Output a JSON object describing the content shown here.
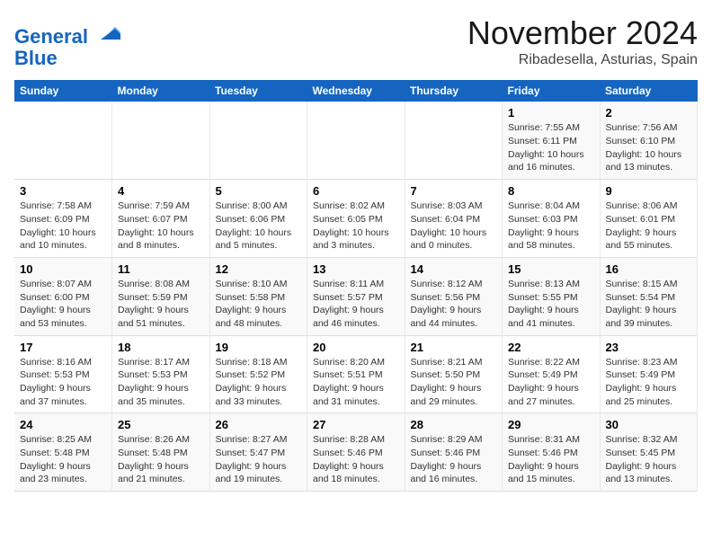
{
  "header": {
    "logo_line1": "General",
    "logo_line2": "Blue",
    "month": "November 2024",
    "location": "Ribadesella, Asturias, Spain"
  },
  "weekdays": [
    "Sunday",
    "Monday",
    "Tuesday",
    "Wednesday",
    "Thursday",
    "Friday",
    "Saturday"
  ],
  "weeks": [
    [
      {
        "day": "",
        "info": ""
      },
      {
        "day": "",
        "info": ""
      },
      {
        "day": "",
        "info": ""
      },
      {
        "day": "",
        "info": ""
      },
      {
        "day": "",
        "info": ""
      },
      {
        "day": "1",
        "info": "Sunrise: 7:55 AM\nSunset: 6:11 PM\nDaylight: 10 hours and 16 minutes."
      },
      {
        "day": "2",
        "info": "Sunrise: 7:56 AM\nSunset: 6:10 PM\nDaylight: 10 hours and 13 minutes."
      }
    ],
    [
      {
        "day": "3",
        "info": "Sunrise: 7:58 AM\nSunset: 6:09 PM\nDaylight: 10 hours and 10 minutes."
      },
      {
        "day": "4",
        "info": "Sunrise: 7:59 AM\nSunset: 6:07 PM\nDaylight: 10 hours and 8 minutes."
      },
      {
        "day": "5",
        "info": "Sunrise: 8:00 AM\nSunset: 6:06 PM\nDaylight: 10 hours and 5 minutes."
      },
      {
        "day": "6",
        "info": "Sunrise: 8:02 AM\nSunset: 6:05 PM\nDaylight: 10 hours and 3 minutes."
      },
      {
        "day": "7",
        "info": "Sunrise: 8:03 AM\nSunset: 6:04 PM\nDaylight: 10 hours and 0 minutes."
      },
      {
        "day": "8",
        "info": "Sunrise: 8:04 AM\nSunset: 6:03 PM\nDaylight: 9 hours and 58 minutes."
      },
      {
        "day": "9",
        "info": "Sunrise: 8:06 AM\nSunset: 6:01 PM\nDaylight: 9 hours and 55 minutes."
      }
    ],
    [
      {
        "day": "10",
        "info": "Sunrise: 8:07 AM\nSunset: 6:00 PM\nDaylight: 9 hours and 53 minutes."
      },
      {
        "day": "11",
        "info": "Sunrise: 8:08 AM\nSunset: 5:59 PM\nDaylight: 9 hours and 51 minutes."
      },
      {
        "day": "12",
        "info": "Sunrise: 8:10 AM\nSunset: 5:58 PM\nDaylight: 9 hours and 48 minutes."
      },
      {
        "day": "13",
        "info": "Sunrise: 8:11 AM\nSunset: 5:57 PM\nDaylight: 9 hours and 46 minutes."
      },
      {
        "day": "14",
        "info": "Sunrise: 8:12 AM\nSunset: 5:56 PM\nDaylight: 9 hours and 44 minutes."
      },
      {
        "day": "15",
        "info": "Sunrise: 8:13 AM\nSunset: 5:55 PM\nDaylight: 9 hours and 41 minutes."
      },
      {
        "day": "16",
        "info": "Sunrise: 8:15 AM\nSunset: 5:54 PM\nDaylight: 9 hours and 39 minutes."
      }
    ],
    [
      {
        "day": "17",
        "info": "Sunrise: 8:16 AM\nSunset: 5:53 PM\nDaylight: 9 hours and 37 minutes."
      },
      {
        "day": "18",
        "info": "Sunrise: 8:17 AM\nSunset: 5:53 PM\nDaylight: 9 hours and 35 minutes."
      },
      {
        "day": "19",
        "info": "Sunrise: 8:18 AM\nSunset: 5:52 PM\nDaylight: 9 hours and 33 minutes."
      },
      {
        "day": "20",
        "info": "Sunrise: 8:20 AM\nSunset: 5:51 PM\nDaylight: 9 hours and 31 minutes."
      },
      {
        "day": "21",
        "info": "Sunrise: 8:21 AM\nSunset: 5:50 PM\nDaylight: 9 hours and 29 minutes."
      },
      {
        "day": "22",
        "info": "Sunrise: 8:22 AM\nSunset: 5:49 PM\nDaylight: 9 hours and 27 minutes."
      },
      {
        "day": "23",
        "info": "Sunrise: 8:23 AM\nSunset: 5:49 PM\nDaylight: 9 hours and 25 minutes."
      }
    ],
    [
      {
        "day": "24",
        "info": "Sunrise: 8:25 AM\nSunset: 5:48 PM\nDaylight: 9 hours and 23 minutes."
      },
      {
        "day": "25",
        "info": "Sunrise: 8:26 AM\nSunset: 5:48 PM\nDaylight: 9 hours and 21 minutes."
      },
      {
        "day": "26",
        "info": "Sunrise: 8:27 AM\nSunset: 5:47 PM\nDaylight: 9 hours and 19 minutes."
      },
      {
        "day": "27",
        "info": "Sunrise: 8:28 AM\nSunset: 5:46 PM\nDaylight: 9 hours and 18 minutes."
      },
      {
        "day": "28",
        "info": "Sunrise: 8:29 AM\nSunset: 5:46 PM\nDaylight: 9 hours and 16 minutes."
      },
      {
        "day": "29",
        "info": "Sunrise: 8:31 AM\nSunset: 5:46 PM\nDaylight: 9 hours and 15 minutes."
      },
      {
        "day": "30",
        "info": "Sunrise: 8:32 AM\nSunset: 5:45 PM\nDaylight: 9 hours and 13 minutes."
      }
    ]
  ]
}
